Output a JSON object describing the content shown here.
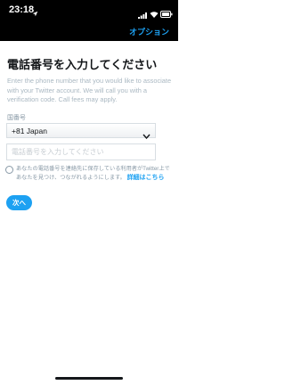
{
  "status_bar": {
    "time": "23:18"
  },
  "icons": {
    "location": "location-arrow-icon",
    "signal": "cellular-signal-icon",
    "wifi": "wifi-icon",
    "battery": "battery-icon",
    "chevron": "chevron-down-icon"
  },
  "header": {
    "options_label": "オプション"
  },
  "main": {
    "title": "電話番号を入力してください",
    "description": "Enter the phone number that you would like to associate with your Twitter account. We will call you with a verification code. Call fees may apply.",
    "country_label": "国番号",
    "country_value": "+81 Japan",
    "phone_placeholder": "電話番号を入力してください",
    "discover_text": "あなたの電話番号を連絡先に保存している利用者がTwitter上であなたを見つけ、つながれるようにします。",
    "learn_more": "詳細はこちら",
    "next_label": "次へ"
  },
  "colors": {
    "accent": "#1DA1F2",
    "status_bar_bg": "#000000",
    "text": "#14171A",
    "muted_text": "#AAB8C2"
  }
}
